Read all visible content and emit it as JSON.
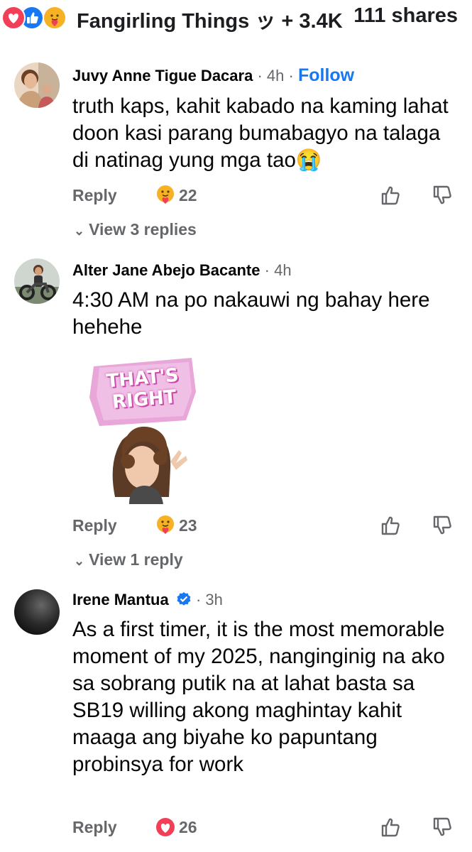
{
  "header": {
    "page_name": "Fangirling Things ッ",
    "reaction_count": "+ 3.4K",
    "shares": "111 shares",
    "reaction_icons": [
      "love-icon",
      "like-icon",
      "care-icon"
    ]
  },
  "comments": [
    {
      "author": "Juvy Anne Tigue Dacara",
      "time": "4h",
      "follow_label": "Follow",
      "text": "truth kaps, kahit kabado na kaming lahat doon kasi parang bumabagyo na talaga di natinag yung mga tao😭",
      "reply_label": "Reply",
      "reaction_icon": "care-icon",
      "reaction_count": "22",
      "view_replies": "View 3 replies"
    },
    {
      "author": "Alter Jane Abejo Bacante",
      "time": "4h",
      "text": "4:30 AM na po nakauwi ng bahay here hehehe",
      "sticker_text": "THAT'S RIGHT",
      "reply_label": "Reply",
      "reaction_icon": "care-icon",
      "reaction_count": "23",
      "view_replies": "View 1 reply"
    },
    {
      "author": "Irene Mantua",
      "verified": true,
      "time": "3h",
      "text": "As a first timer, it is the most memorable moment of my 2025, nanginginig na ako sa sobrang putik na at lahat basta sa SB19 willing akong maghintay kahit maaga ang biyahe ko papuntang probinsya for work",
      "reply_label": "Reply",
      "reaction_icon": "love-icon",
      "reaction_count": "26"
    }
  ],
  "colors": {
    "love": "#f33e58",
    "like": "#1877f2",
    "care": "#f7b125",
    "secondary_text": "#65676b",
    "link": "#1877f2"
  }
}
